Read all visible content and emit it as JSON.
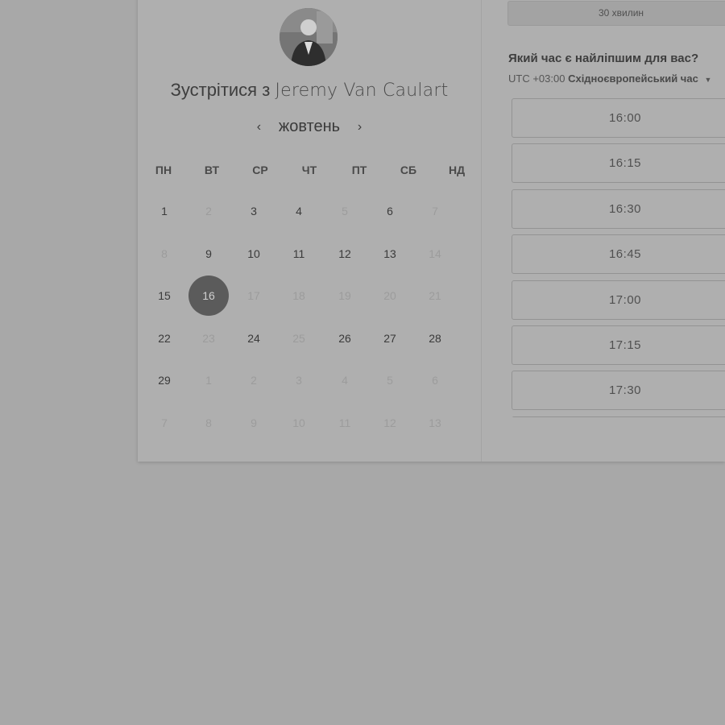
{
  "host": {
    "title_prefix": "Зустрітися з",
    "name": "Jeremy Van Caulart"
  },
  "calendar": {
    "month": "жовтень",
    "weekdays": [
      "ПН",
      "ВТ",
      "СР",
      "ЧТ",
      "ПТ",
      "СБ",
      "НД"
    ],
    "weeks": [
      [
        {
          "d": "1",
          "s": "available"
        },
        {
          "d": "2",
          "s": "disabled"
        },
        {
          "d": "3",
          "s": "available"
        },
        {
          "d": "4",
          "s": "available"
        },
        {
          "d": "5",
          "s": "disabled"
        },
        {
          "d": "6",
          "s": "available"
        },
        {
          "d": "7",
          "s": "disabled"
        }
      ],
      [
        {
          "d": "8",
          "s": "disabled"
        },
        {
          "d": "9",
          "s": "available"
        },
        {
          "d": "10",
          "s": "available"
        },
        {
          "d": "11",
          "s": "available"
        },
        {
          "d": "12",
          "s": "available"
        },
        {
          "d": "13",
          "s": "available"
        },
        {
          "d": "14",
          "s": "disabled"
        }
      ],
      [
        {
          "d": "15",
          "s": "available"
        },
        {
          "d": "16",
          "s": "selected"
        },
        {
          "d": "17",
          "s": "disabled"
        },
        {
          "d": "18",
          "s": "disabled"
        },
        {
          "d": "19",
          "s": "disabled"
        },
        {
          "d": "20",
          "s": "disabled"
        },
        {
          "d": "21",
          "s": "disabled"
        }
      ],
      [
        {
          "d": "22",
          "s": "available"
        },
        {
          "d": "23",
          "s": "disabled"
        },
        {
          "d": "24",
          "s": "available"
        },
        {
          "d": "25",
          "s": "disabled"
        },
        {
          "d": "26",
          "s": "available"
        },
        {
          "d": "27",
          "s": "available"
        },
        {
          "d": "28",
          "s": "available"
        }
      ],
      [
        {
          "d": "29",
          "s": "available"
        },
        {
          "d": "1",
          "s": "disabled"
        },
        {
          "d": "2",
          "s": "disabled"
        },
        {
          "d": "3",
          "s": "disabled"
        },
        {
          "d": "4",
          "s": "disabled"
        },
        {
          "d": "5",
          "s": "disabled"
        },
        {
          "d": "6",
          "s": "disabled"
        }
      ],
      [
        {
          "d": "7",
          "s": "disabled"
        },
        {
          "d": "8",
          "s": "disabled"
        },
        {
          "d": "9",
          "s": "disabled"
        },
        {
          "d": "10",
          "s": "disabled"
        },
        {
          "d": "11",
          "s": "disabled"
        },
        {
          "d": "12",
          "s": "disabled"
        },
        {
          "d": "13",
          "s": "disabled"
        }
      ]
    ]
  },
  "booking": {
    "duration": "30 хвилин",
    "question": "Який час є найліпшим для вас?",
    "timezone_offset": "UTC +03:00",
    "timezone_name": "Східноєвропейський час",
    "slots": [
      "16:00",
      "16:15",
      "16:30",
      "16:45",
      "17:00",
      "17:15",
      "17:30",
      ""
    ]
  },
  "icons": {
    "prev": "chevron-left-icon",
    "next": "chevron-right-icon",
    "timezone_dropdown": "caret-down-icon"
  },
  "colors": {
    "selected_day": "#5b5b5b",
    "page_background": "#a8a8a8",
    "card_background": "#afafaf"
  }
}
